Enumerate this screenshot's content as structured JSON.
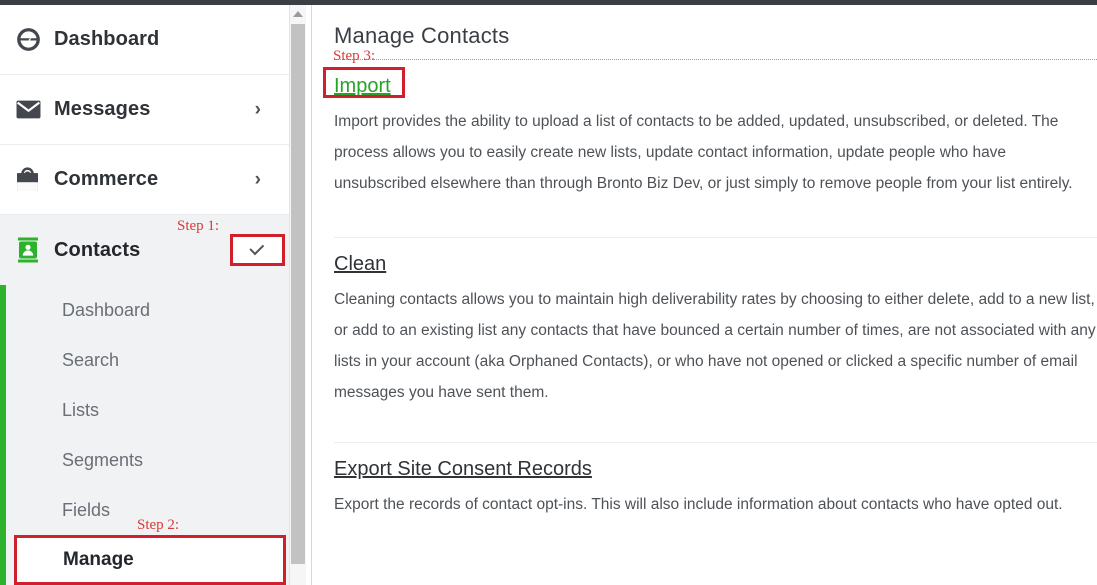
{
  "sidebar": {
    "top_items": [
      {
        "label": "Dashboard",
        "icon": "gauge-icon",
        "has_chevron": false
      },
      {
        "label": "Messages",
        "icon": "envelope-icon",
        "has_chevron": true
      },
      {
        "label": "Commerce",
        "icon": "shopping-bag-icon",
        "has_chevron": true
      }
    ],
    "active_item": {
      "label": "Contacts",
      "icon": "contact-card-icon",
      "chevron": "chevron-down-icon"
    },
    "sub_items": [
      {
        "label": "Dashboard"
      },
      {
        "label": "Search"
      },
      {
        "label": "Lists"
      },
      {
        "label": "Segments"
      },
      {
        "label": "Fields"
      }
    ],
    "current_sub_item": {
      "label": "Manage"
    }
  },
  "annotations": {
    "step1": "Step 1:",
    "step2": "Step 2:",
    "step3": "Step 3:"
  },
  "main": {
    "title": "Manage Contacts",
    "sections": [
      {
        "link": "Import",
        "body": "Import provides the ability to upload a list of contacts to be added, updated, unsubscribed, or deleted. The process allows you to easily create new lists, update contact information, update people who have unsubscribed elsewhere than through Bronto Biz Dev, or just simply to remove people from your list entirely."
      },
      {
        "link": "Clean",
        "body": "Cleaning contacts allows you to maintain high deliverability rates by choosing to either delete, add to a new list, or add to an existing list any contacts that have bounced a certain number of times, are not associated with any lists in your account (aka Orphaned Contacts), or who have not opened or clicked a specific number of email messages you have sent them."
      },
      {
        "link": "Export Site Consent Records",
        "body": "Export the records of contact opt-ins. This will also include information about contacts who have opted out."
      }
    ]
  },
  "colors": {
    "accent_green": "#2cb22c",
    "annotation_red": "#d0202c",
    "link_green": "#27a327"
  }
}
